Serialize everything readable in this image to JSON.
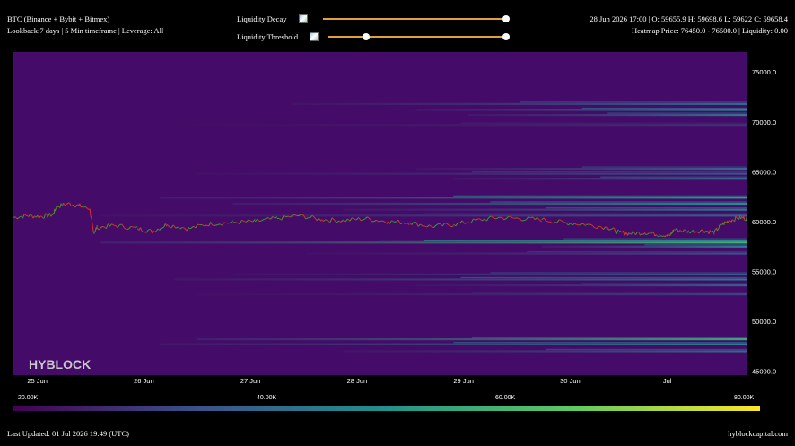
{
  "header": {
    "symbol": "BTC (Binance + Bybit + Bitmex)",
    "settings": "Lookback:7 days | 5 Min timeframe | Leverage: All",
    "decay_label": "Liquidity Decay",
    "threshold_label": "Liquidity Threshold",
    "decay_value": 1.0,
    "threshold_low": 0.19,
    "threshold_high": 1.0,
    "ohlc": "28 Jun 2026 17:00 | O: 59655.9 H: 59698.6 L: 59622 C: 59658.4",
    "heatmap_info": "Heatmap Price: 76450.0 - 76500.0 | Liquidity: 0.00"
  },
  "watermark": "HYBLOCK",
  "footer": {
    "updated": "Last Updated: 01 Jul 2026 19:49 (UTC)",
    "site": "hyblockcapital.com"
  },
  "colorbar": {
    "labels": [
      "20.00K",
      "40.00K",
      "60.00K",
      "80.00K"
    ],
    "stops": [
      "#440154",
      "#3b528b",
      "#21918c",
      "#5ec962",
      "#fde725"
    ]
  },
  "colors": {
    "background": "#450b68",
    "candle_up": "#2f9e2f",
    "candle_down": "#d93025",
    "slider": "#e0a040"
  },
  "chart_data": {
    "type": "heatmap",
    "x_ticks": [
      "25 Jun",
      "26 Jun",
      "27 Jun",
      "28 Jun",
      "29 Jun",
      "30 Jun",
      "Jul"
    ],
    "y_ticks": [
      "75000.0",
      "70000.0",
      "65000.0",
      "60000.0",
      "55000.0",
      "50000.0",
      "45000.0"
    ],
    "ylim": [
      44600,
      77000
    ],
    "colorbar_range": [
      20000,
      80000
    ],
    "liquidity_bands": [
      {
        "price": 71800,
        "start": 0.38,
        "intensity": 0.35
      },
      {
        "price": 71200,
        "start": 0.55,
        "intensity": 0.45
      },
      {
        "price": 70700,
        "start": 0.62,
        "intensity": 0.4
      },
      {
        "price": 69700,
        "start": 0.22,
        "intensity": 0.15
      },
      {
        "price": 65300,
        "start": 0.55,
        "intensity": 0.35
      },
      {
        "price": 64800,
        "start": 0.25,
        "intensity": 0.25
      },
      {
        "price": 64300,
        "start": 0.6,
        "intensity": 0.4
      },
      {
        "price": 62400,
        "start": 0.2,
        "intensity": 0.55
      },
      {
        "price": 61800,
        "start": 0.3,
        "intensity": 0.5
      },
      {
        "price": 61200,
        "start": 0.45,
        "intensity": 0.4
      },
      {
        "price": 60600,
        "start": 0.12,
        "intensity": 0.3
      },
      {
        "price": 58100,
        "start": 0.5,
        "intensity": 0.4
      },
      {
        "price": 57900,
        "start": 0.12,
        "intensity": 0.65
      },
      {
        "price": 57500,
        "start": 0.72,
        "intensity": 0.45
      },
      {
        "price": 56800,
        "start": 0.4,
        "intensity": 0.25
      },
      {
        "price": 54700,
        "start": 0.3,
        "intensity": 0.3
      },
      {
        "price": 54200,
        "start": 0.22,
        "intensity": 0.4
      },
      {
        "price": 53600,
        "start": 0.55,
        "intensity": 0.3
      },
      {
        "price": 52700,
        "start": 0.25,
        "intensity": 0.2
      },
      {
        "price": 48200,
        "start": 0.25,
        "intensity": 0.6
      },
      {
        "price": 47700,
        "start": 0.2,
        "intensity": 0.45
      },
      {
        "price": 47000,
        "start": 0.45,
        "intensity": 0.35
      }
    ],
    "price_path": [
      [
        0.0,
        60400
      ],
      [
        0.02,
        60600
      ],
      [
        0.04,
        60500
      ],
      [
        0.055,
        60700
      ],
      [
        0.06,
        61500
      ],
      [
        0.075,
        61800
      ],
      [
        0.09,
        61600
      ],
      [
        0.105,
        61300
      ],
      [
        0.11,
        58900
      ],
      [
        0.115,
        59400
      ],
      [
        0.14,
        59600
      ],
      [
        0.17,
        59300
      ],
      [
        0.19,
        59000
      ],
      [
        0.21,
        59700
      ],
      [
        0.24,
        59300
      ],
      [
        0.27,
        59800
      ],
      [
        0.3,
        59900
      ],
      [
        0.33,
        60000
      ],
      [
        0.36,
        60300
      ],
      [
        0.39,
        60600
      ],
      [
        0.42,
        60200
      ],
      [
        0.45,
        60100
      ],
      [
        0.48,
        60300
      ],
      [
        0.51,
        60000
      ],
      [
        0.54,
        59900
      ],
      [
        0.57,
        59500
      ],
      [
        0.6,
        59700
      ],
      [
        0.63,
        60100
      ],
      [
        0.66,
        60400
      ],
      [
        0.69,
        60300
      ],
      [
        0.72,
        60200
      ],
      [
        0.75,
        59900
      ],
      [
        0.78,
        59700
      ],
      [
        0.81,
        59400
      ],
      [
        0.825,
        58900
      ],
      [
        0.84,
        58800
      ],
      [
        0.86,
        58900
      ],
      [
        0.88,
        58700
      ],
      [
        0.895,
        58600
      ],
      [
        0.9,
        59200
      ],
      [
        0.92,
        59000
      ],
      [
        0.94,
        59100
      ],
      [
        0.955,
        58900
      ],
      [
        0.965,
        59700
      ],
      [
        0.975,
        60100
      ],
      [
        0.99,
        60400
      ],
      [
        1.0,
        60300
      ]
    ]
  }
}
